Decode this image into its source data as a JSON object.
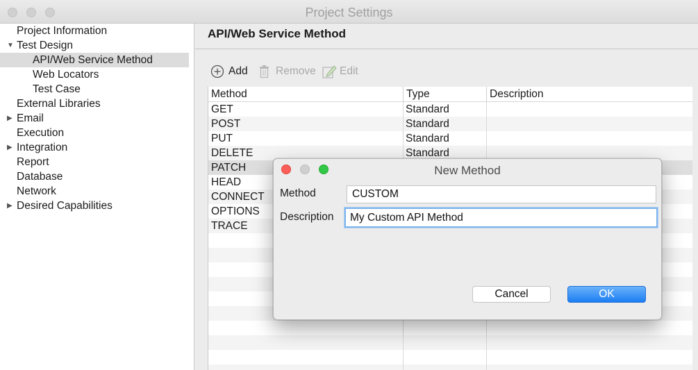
{
  "window": {
    "title": "Project Settings"
  },
  "sidebar": {
    "items": [
      {
        "label": "Project Information",
        "indent": 0,
        "expander": "none",
        "selected": false
      },
      {
        "label": "Test Design",
        "indent": 0,
        "expander": "expanded",
        "selected": false
      },
      {
        "label": "API/Web Service Method",
        "indent": 1,
        "expander": "none",
        "selected": true
      },
      {
        "label": "Web Locators",
        "indent": 1,
        "expander": "none",
        "selected": false
      },
      {
        "label": "Test Case",
        "indent": 1,
        "expander": "none",
        "selected": false
      },
      {
        "label": "External Libraries",
        "indent": 0,
        "expander": "none",
        "selected": false
      },
      {
        "label": "Email",
        "indent": 0,
        "expander": "collapsed",
        "selected": false
      },
      {
        "label": "Execution",
        "indent": 0,
        "expander": "none",
        "selected": false
      },
      {
        "label": "Integration",
        "indent": 0,
        "expander": "collapsed",
        "selected": false
      },
      {
        "label": "Report",
        "indent": 0,
        "expander": "none",
        "selected": false
      },
      {
        "label": "Database",
        "indent": 0,
        "expander": "none",
        "selected": false
      },
      {
        "label": "Network",
        "indent": 0,
        "expander": "none",
        "selected": false
      },
      {
        "label": "Desired Capabilities",
        "indent": 0,
        "expander": "collapsed",
        "selected": false
      }
    ]
  },
  "main": {
    "title": "API/Web Service Method",
    "toolbar": {
      "add_label": "Add",
      "remove_label": "Remove",
      "edit_label": "Edit"
    },
    "table": {
      "headers": [
        "Method",
        "Type",
        "Description"
      ],
      "rows": [
        {
          "method": "GET",
          "type": "Standard",
          "description": ""
        },
        {
          "method": "POST",
          "type": "Standard",
          "description": ""
        },
        {
          "method": "PUT",
          "type": "Standard",
          "description": ""
        },
        {
          "method": "DELETE",
          "type": "Standard",
          "description": ""
        },
        {
          "method": "PATCH",
          "type": "",
          "description": ""
        },
        {
          "method": "HEAD",
          "type": "",
          "description": ""
        },
        {
          "method": "CONNECT",
          "type": "",
          "description": ""
        },
        {
          "method": "OPTIONS",
          "type": "",
          "description": ""
        },
        {
          "method": "TRACE",
          "type": "",
          "description": ""
        }
      ]
    }
  },
  "dialog": {
    "title": "New Method",
    "method_label": "Method",
    "method_value": "CUSTOM",
    "description_label": "Description",
    "description_value": "My Custom API Method",
    "cancel_label": "Cancel",
    "ok_label": "OK"
  },
  "colors": {
    "close": "#fc5f57",
    "minimize": "#cfcfcf",
    "zoom": "#33c748",
    "ok_button": "#1c7ef2",
    "selection": "#dcdcdc",
    "focus_ring": "#7fb4ec"
  },
  "icons": {
    "add": "plus-circle-icon",
    "remove": "trash-icon",
    "edit": "pencil-icon",
    "expanded": "triangle-down-icon",
    "collapsed": "triangle-right-icon"
  }
}
